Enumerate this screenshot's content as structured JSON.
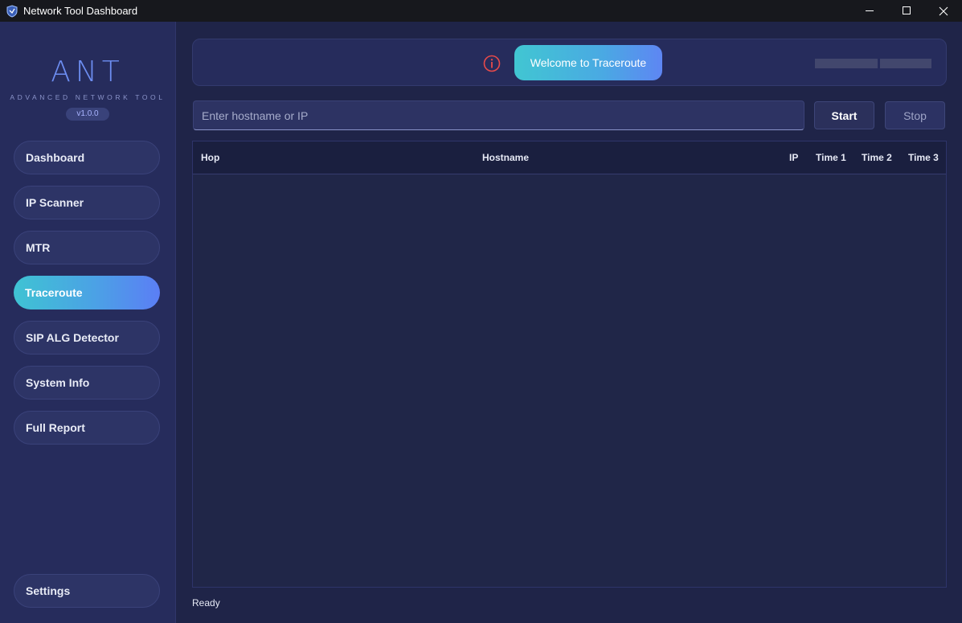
{
  "window": {
    "title": "Network Tool Dashboard",
    "controls": [
      "minimize-icon",
      "maximize-icon",
      "close-icon"
    ]
  },
  "sidebar": {
    "logo": "ANT",
    "subtitle": "ADVANCED NETWORK TOOL",
    "version": "v1.0.0",
    "items": [
      {
        "label": "Dashboard",
        "active": false
      },
      {
        "label": "IP Scanner",
        "active": false
      },
      {
        "label": "MTR",
        "active": false
      },
      {
        "label": "Traceroute",
        "active": true
      },
      {
        "label": "SIP ALG Detector",
        "active": false
      },
      {
        "label": "System Info",
        "active": false
      },
      {
        "label": "Full Report",
        "active": false
      }
    ],
    "settings_label": "Settings"
  },
  "banner": {
    "icon": "info-icon",
    "message": "Welcome to Traceroute"
  },
  "input": {
    "placeholder": "Enter hostname or IP",
    "value": ""
  },
  "buttons": {
    "start": "Start",
    "stop": "Stop"
  },
  "table": {
    "columns": [
      "Hop",
      "Hostname",
      "IP",
      "Time 1",
      "Time 2",
      "Time 3"
    ],
    "rows": []
  },
  "status": "Ready",
  "colors": {
    "accent_start": "#41c6d2",
    "accent_end": "#5e86f3",
    "background": "#1f2448",
    "sidebar": "#262c5c",
    "info_icon": "#e84a4a"
  }
}
